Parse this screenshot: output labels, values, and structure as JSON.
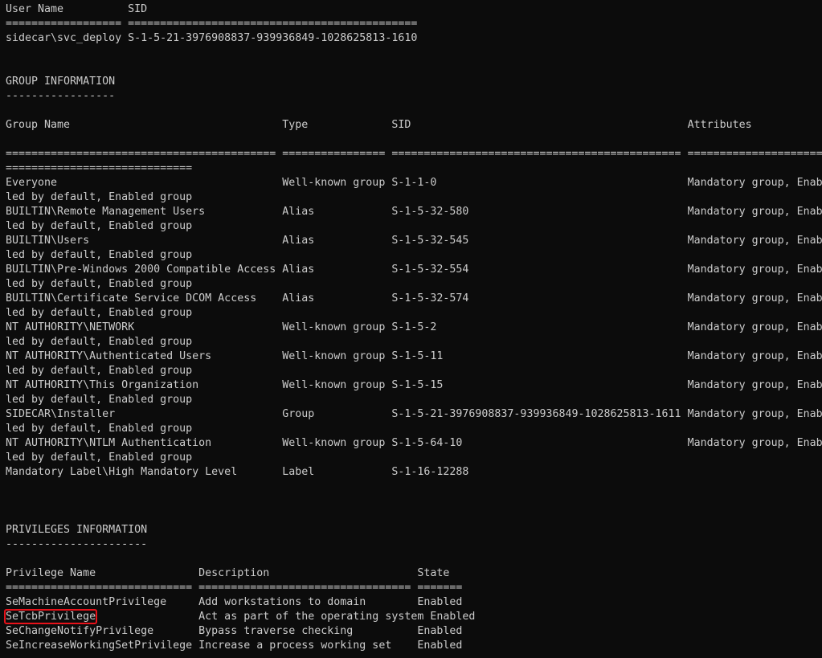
{
  "lines": [
    "User Name          SID",
    "================== =============================================",
    "sidecar\\svc_deploy S-1-5-21-3976908837-939936849-1028625813-1610",
    "",
    "",
    "GROUP INFORMATION",
    "-----------------",
    "",
    "Group Name                                 Type             SID                                           Attributes",
    "",
    "========================================== ================ ============================================= =========================",
    "=============================",
    "Everyone                                   Well-known group S-1-1-0                                       Mandatory group, Enab",
    "led by default, Enabled group",
    "BUILTIN\\Remote Management Users            Alias            S-1-5-32-580                                  Mandatory group, Enab",
    "led by default, Enabled group",
    "BUILTIN\\Users                              Alias            S-1-5-32-545                                  Mandatory group, Enab",
    "led by default, Enabled group",
    "BUILTIN\\Pre-Windows 2000 Compatible Access Alias            S-1-5-32-554                                  Mandatory group, Enab",
    "led by default, Enabled group",
    "BUILTIN\\Certificate Service DCOM Access    Alias            S-1-5-32-574                                  Mandatory group, Enab",
    "led by default, Enabled group",
    "NT AUTHORITY\\NETWORK                       Well-known group S-1-5-2                                       Mandatory group, Enab",
    "led by default, Enabled group",
    "NT AUTHORITY\\Authenticated Users           Well-known group S-1-5-11                                      Mandatory group, Enab",
    "led by default, Enabled group",
    "NT AUTHORITY\\This Organization             Well-known group S-1-5-15                                      Mandatory group, Enab",
    "led by default, Enabled group",
    "SIDECAR\\Installer                          Group            S-1-5-21-3976908837-939936849-1028625813-1611 Mandatory group, Enab",
    "led by default, Enabled group",
    "NT AUTHORITY\\NTLM Authentication           Well-known group S-1-5-64-10                                   Mandatory group, Enab",
    "led by default, Enabled group",
    "Mandatory Label\\High Mandatory Level       Label            S-1-16-12288",
    "",
    "",
    "",
    "PRIVILEGES INFORMATION",
    "----------------------",
    "",
    "Privilege Name                Description                       State",
    "============================= ================================= =======",
    "SeMachineAccountPrivilege     Add workstations to domain        Enabled"
  ],
  "highlighted_line": {
    "name": "SeTcbPrivilege",
    "rest": "                Act as part of the operating system Enabled"
  },
  "trailing_lines": [
    "SeChangeNotifyPrivilege       Bypass traverse checking          Enabled",
    "SeIncreaseWorkingSetPrivilege Increase a process working set    Enabled"
  ],
  "colors": {
    "background": "#0c0c0c",
    "foreground": "#cccccc",
    "highlight_box": "#e8121a"
  }
}
